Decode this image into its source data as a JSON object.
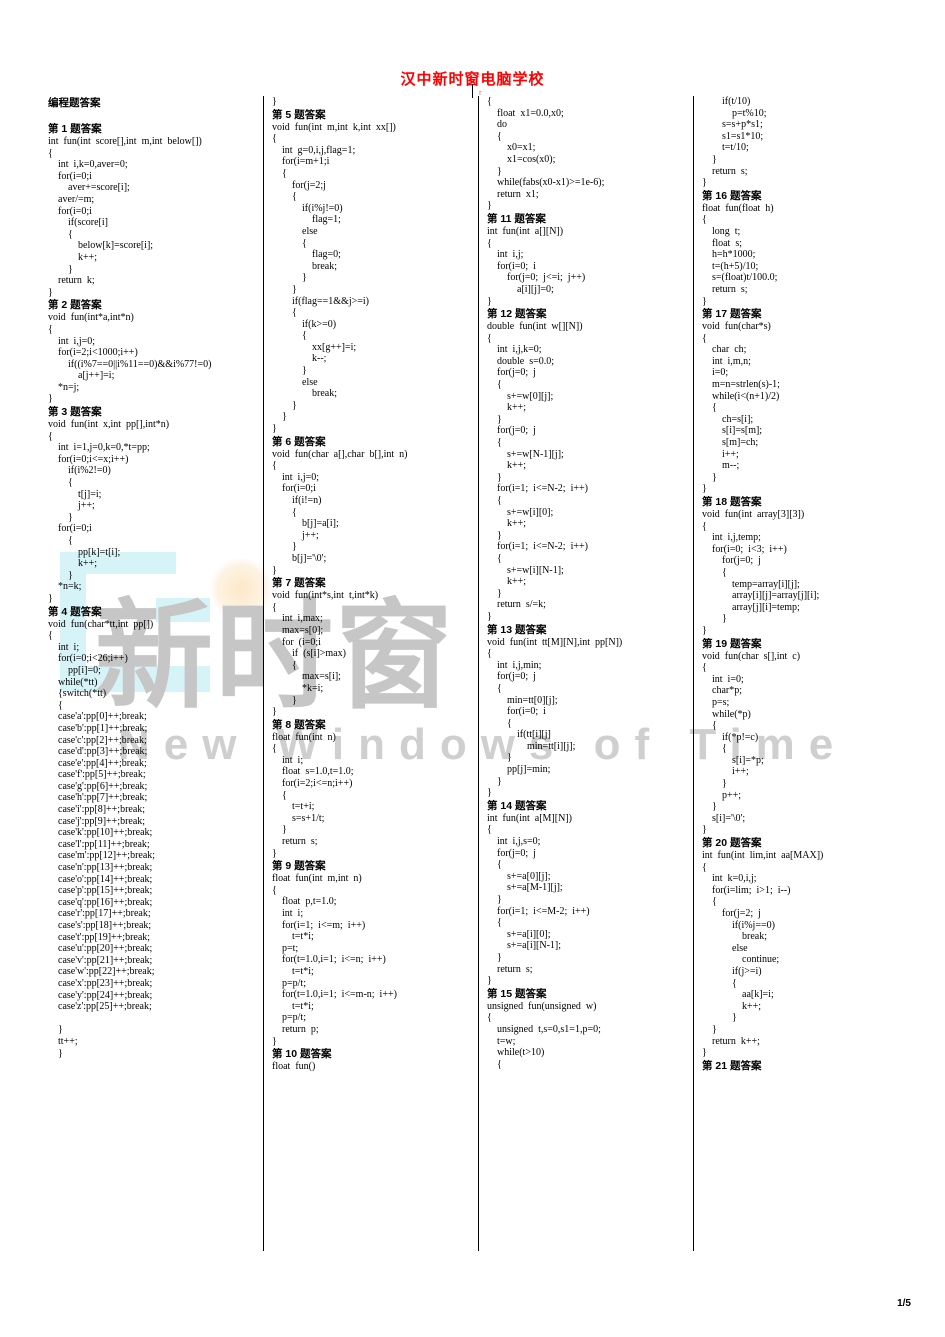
{
  "document": {
    "title": "汉中新时窗电脑学校",
    "title_color": "#ff0000",
    "page_number": "1/5",
    "section_heading": "编程题答案"
  },
  "watermark": {
    "cn_text": "新时窗",
    "en_text": "New  Windows  of  Time",
    "cn_color": "#c6c6c6",
    "accent_color": "#d6f3f8"
  },
  "columns": [
    {
      "id": "column-1",
      "blocks": [
        {
          "type": "heading",
          "text": "第 1 题答案"
        },
        {
          "type": "code",
          "text": "int  fun(int  score[],int  m,int  below[])\n{\n    int  i,k=0,aver=0;\n    for(i=0;i\n        aver+=score[i];\n    aver/=m;\n    for(i=0;i\n        if(score[i]\n        {\n            below[k]=score[i];\n            k++;\n        }\n    return  k;\n}"
        },
        {
          "type": "heading",
          "text": "第 2 题答案"
        },
        {
          "type": "code",
          "text": "void  fun(int*a,int*n)\n{\n    int  i,j=0;\n    for(i=2;i<1000;i++)\n        if((i%7==0||i%11==0)&&i%77!=0)\n            a[j++]=i;\n    *n=j;\n}"
        },
        {
          "type": "heading",
          "text": "第 3 题答案"
        },
        {
          "type": "code",
          "text": "void  fun(int  x,int  pp[],int*n)\n{\n    int  i=1,j=0,k=0,*t=pp;\n    for(i=0;i<=x;i++)\n        if(i%2!=0)\n        {\n            t[j]=i;\n            j++;\n        }\n    for(i=0;i\n        {\n            pp[k]=t[i];\n            k++;\n        }\n    *n=k;\n}"
        },
        {
          "type": "heading",
          "text": "第 4 题答案"
        },
        {
          "type": "code",
          "text": "void  fun(char*tt,int  pp[])\n{\n    int  i;\n    for(i=0;i<26;i++)\n        pp[i]=0;\n    while(*tt)\n    {switch(*tt)\n    {\n    case'a':pp[0]++;break;\n    case'b':pp[1]++;break;\n    case'c':pp[2]++;break;\n    case'd':pp[3]++;break;\n    case'e':pp[4]++;break;\n    case'f':pp[5]++;break;\n    case'g':pp[6]++;break;\n    case'h':pp[7]++;break;\n    case'i':pp[8]++;break;\n    case'j':pp[9]++;break;\n    case'k':pp[10]++;break;\n    case'l':pp[11]++;break;\n    case'm':pp[12]++;break;\n    case'n':pp[13]++;break;\n    case'o':pp[14]++;break;\n    case'p':pp[15]++;break;\n    case'q':pp[16]++;break;\n    case'r':pp[17]++;break;\n    case's':pp[18]++;break;\n    case't':pp[19]++;break;\n    case'u':pp[20]++;break;\n    case'v':pp[21]++;break;\n    case'w':pp[22]++;break;\n    case'x':pp[23]++;break;\n    case'y':pp[24]++;break;\n    case'z':pp[25]++;break;\n\n    }\n    tt++;\n    }"
        }
      ]
    },
    {
      "id": "column-2",
      "blocks": [
        {
          "type": "code",
          "text": "}"
        },
        {
          "type": "heading",
          "text": "第 5 题答案"
        },
        {
          "type": "code",
          "text": "void  fun(int  m,int  k,int  xx[])\n{\n    int  g=0,i,j,flag=1;\n    for(i=m+1;i\n    {\n        for(j=2;j\n        {\n            if(i%j!=0)\n                flag=1;\n            else\n            {\n                flag=0;\n                break;\n            }\n        }\n        if(flag==1&&j>=i)\n        {\n            if(k>=0)\n            {\n                xx[g++]=i;\n                k--;\n            }\n            else\n                break;\n        }\n    }\n}"
        },
        {
          "type": "heading",
          "text": "第 6 题答案"
        },
        {
          "type": "code",
          "text": "void  fun(char  a[],char  b[],int  n)\n{\n    int  i,j=0;\n    for(i=0;i\n        if(i!=n)\n        {\n            b[j]=a[i];\n            j++;\n        }\n        b[j]='\\0';\n}"
        },
        {
          "type": "heading",
          "text": "第 7 题答案"
        },
        {
          "type": "code",
          "text": "void  fun(int*s,int  t,int*k)\n{\n    int  i,max;\n    max=s[0];\n    for  (i=0;i\n        if  (s[i]>max)\n        {\n            max=s[i];\n            *k=i;\n        }\n}"
        },
        {
          "type": "heading",
          "text": "第 8 题答案"
        },
        {
          "type": "code",
          "text": "float  fun(int  n)\n{\n    int  i;\n    float  s=1.0,t=1.0;\n    for(i=2;i<=n;i++)\n    {\n        t=t+i;\n        s=s+1/t;\n    }\n    return  s;\n}"
        },
        {
          "type": "heading",
          "text": "第 9 题答案"
        },
        {
          "type": "code",
          "text": "float  fun(int  m,int  n)\n{\n    float  p,t=1.0;\n    int  i;\n    for(i=1;  i<=m;  i++)\n        t=t*i;\n    p=t;\n    for(t=1.0,i=1;  i<=n;  i++)\n        t=t*i;\n    p=p/t;\n    for(t=1.0,i=1;  i<=m-n;  i++)\n        t=t*i;\n    p=p/t;\n    return  p;\n}"
        },
        {
          "type": "heading",
          "text": "第 10 题答案"
        },
        {
          "type": "code",
          "text": "float  fun()"
        }
      ]
    },
    {
      "id": "column-3",
      "blocks": [
        {
          "type": "code",
          "text": "{\n    float  x1=0.0,x0;\n    do\n    {\n        x0=x1;\n        x1=cos(x0);\n    }\n    while(fabs(x0-x1)>=1e-6);\n    return  x1;\n}"
        },
        {
          "type": "heading",
          "text": "第 11 题答案"
        },
        {
          "type": "code",
          "text": "int  fun(int  a[][N])\n{\n    int  i,j;\n    for(i=0;  i\n        for(j=0;  j<=i;  j++)\n            a[i][j]=0;\n}"
        },
        {
          "type": "heading",
          "text": "第 12 题答案"
        },
        {
          "type": "code",
          "text": "double  fun(int  w[][N])\n{\n    int  i,j,k=0;\n    double  s=0.0;\n    for(j=0;  j\n    {\n        s+=w[0][j];\n        k++;\n    }\n    for(j=0;  j\n    {\n        s+=w[N-1][j];\n        k++;\n    }\n    for(i=1;  i<=N-2;  i++)\n    {\n        s+=w[i][0];\n        k++;\n    }\n    for(i=1;  i<=N-2;  i++)\n    {\n        s+=w[i][N-1];\n        k++;\n    }\n    return  s/=k;\n}"
        },
        {
          "type": "heading",
          "text": "第 13 题答案"
        },
        {
          "type": "code",
          "text": "void  fun(int  tt[M][N],int  pp[N])\n{\n    int  i,j,min;\n    for(j=0;  j\n    {\n        min=tt[0][j];\n        for(i=0;  i\n        {\n            if(tt[i][j]\n                min=tt[i][j];\n        }\n        pp[j]=min;\n    }\n}"
        },
        {
          "type": "heading",
          "text": "第 14 题答案"
        },
        {
          "type": "code",
          "text": "int  fun(int  a[M][N])\n{\n    int  i,j,s=0;\n    for(j=0;  j\n    {\n        s+=a[0][j];\n        s+=a[M-1][j];\n    }\n    for(i=1;  i<=M-2;  i++)\n    {\n        s+=a[i][0];\n        s+=a[i][N-1];\n    }\n    return  s;\n}"
        },
        {
          "type": "heading",
          "text": "第 15 题答案"
        },
        {
          "type": "code",
          "text": "unsigned  fun(unsigned  w)\n{\n    unsigned  t,s=0,s1=1,p=0;\n    t=w;\n    while(t>10)\n    {"
        }
      ]
    },
    {
      "id": "column-4",
      "blocks": [
        {
          "type": "code",
          "text": "        if(t/10)\n            p=t%10;\n        s=s+p*s1;\n        s1=s1*10;\n        t=t/10;\n    }\n    return  s;\n}"
        },
        {
          "type": "heading",
          "text": "第 16 题答案"
        },
        {
          "type": "code",
          "text": "float  fun(float  h)\n{\n    long  t;\n    float  s;\n    h=h*1000;\n    t=(h+5)/10;\n    s=(float)t/100.0;\n    return  s;\n}"
        },
        {
          "type": "heading",
          "text": "第 17 题答案"
        },
        {
          "type": "code",
          "text": "void  fun(char*s)\n{\n    char  ch;\n    int  i,m,n;\n    i=0;\n    m=n=strlen(s)-1;\n    while(i<(n+1)/2)\n    {\n        ch=s[i];\n        s[i]=s[m];\n        s[m]=ch;\n        i++;\n        m--;\n    }\n}"
        },
        {
          "type": "heading",
          "text": "第 18 题答案"
        },
        {
          "type": "code",
          "text": "void  fun(int  array[3][3])\n{\n    int  i,j,temp;\n    for(i=0;  i<3;  i++)\n        for(j=0;  j\n        {\n            temp=array[i][j];\n            array[i][j]=array[j][i];\n            array[j][i]=temp;\n        }\n}"
        },
        {
          "type": "heading",
          "text": "第 19 题答案"
        },
        {
          "type": "code",
          "text": "void  fun(char  s[],int  c)\n{\n    int  i=0;\n    char*p;\n    p=s;\n    while(*p)\n    {\n        if(*p!=c)\n        {\n            s[i]=*p;\n            i++;\n        }\n        p++;\n    }\n    s[i]='\\0';\n}"
        },
        {
          "type": "heading",
          "text": "第 20 题答案"
        },
        {
          "type": "code",
          "text": "int  fun(int  lim,int  aa[MAX])\n{\n    int  k=0,i,j;\n    for(i=lim;  i>1;  i--)\n    {\n        for(j=2;  j\n            if(i%j==0)\n                break;\n            else\n                continue;\n            if(j>=i)\n            {\n                aa[k]=i;\n                k++;\n            }\n    }\n    return  k++;\n}"
        },
        {
          "type": "heading",
          "text": "第 21 题答案"
        }
      ]
    }
  ]
}
